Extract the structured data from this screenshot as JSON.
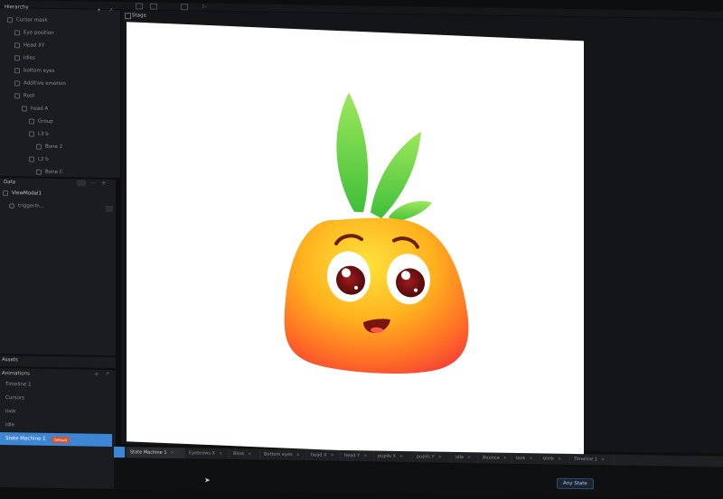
{
  "hierarchy": {
    "title": "Hierarchy",
    "items": [
      {
        "label": "Cursor mask",
        "indent": 0
      },
      {
        "label": "Eye position",
        "indent": 1
      },
      {
        "label": "Head XY",
        "indent": 1
      },
      {
        "label": "Idles",
        "indent": 1
      },
      {
        "label": "bottom eyes",
        "indent": 1
      },
      {
        "label": "Additive emotion",
        "indent": 1
      },
      {
        "label": "Root",
        "indent": 1
      },
      {
        "label": "head A",
        "indent": 2
      },
      {
        "label": "Group",
        "indent": 3
      },
      {
        "label": "L3 b",
        "indent": 3
      },
      {
        "label": "Bone 2",
        "indent": 4
      },
      {
        "label": "L2 b",
        "indent": 3
      },
      {
        "label": "Bone C",
        "indent": 4
      }
    ]
  },
  "data_panel": {
    "title": "Data",
    "viewmodel": "ViewModel1",
    "property": "triggerIn..."
  },
  "assets_title": "Assets",
  "animations": {
    "title": "Animations",
    "items": [
      "Timeline 1",
      "Cursors",
      "look",
      "idle",
      "State Machine 1"
    ],
    "selected_index": 4,
    "badge": "Default"
  },
  "stage": {
    "title": "Stage",
    "background": "#ffffff"
  },
  "timeline_tabs": [
    "State Machine 1",
    "Eyebrows X",
    "Blink",
    "Bottom eyes",
    "head X",
    "head Y",
    "pupils X",
    "pupils Y",
    "idle",
    "Bounce",
    "look",
    "blink",
    "Timeline 1"
  ],
  "any_state": "Any State",
  "colors": {
    "accent": "#3d86d6",
    "panel": "#1b1c1f",
    "app_bg": "#0d0e10"
  }
}
